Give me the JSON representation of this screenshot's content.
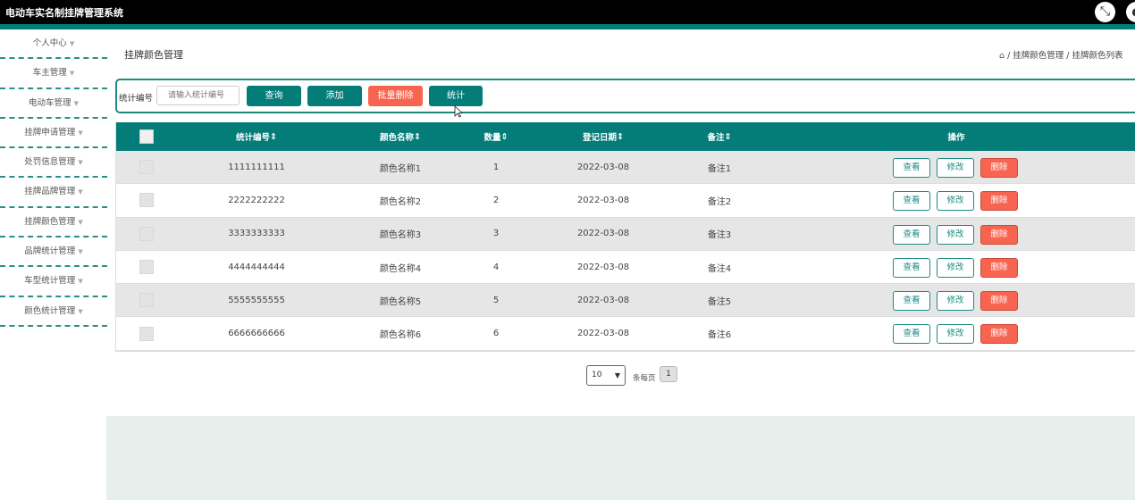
{
  "app": {
    "title": "电动车实名制挂牌管理系统"
  },
  "header_icons": {
    "fullscreen": "collapse-arrows-icon",
    "user": "user-icon"
  },
  "sidebar": {
    "items": [
      {
        "label": "个人中心"
      },
      {
        "label": "车主管理"
      },
      {
        "label": "电动车管理"
      },
      {
        "label": "挂牌申请管理"
      },
      {
        "label": "处罚信息管理"
      },
      {
        "label": "挂牌品牌管理"
      },
      {
        "label": "挂牌颜色管理"
      },
      {
        "label": "品牌统计管理"
      },
      {
        "label": "车型统计管理"
      },
      {
        "label": "颜色统计管理"
      }
    ]
  },
  "page": {
    "title": "挂牌颜色管理",
    "breadcrumb": "/ 挂牌颜色管理 / 挂牌颜色列表"
  },
  "search": {
    "label": "统计编号",
    "placeholder": "请输入统计编号",
    "query_button": "查询",
    "add_button": "添加",
    "batch_delete_button": "批量删除",
    "stats_button": "统计"
  },
  "table": {
    "headers": [
      "统计编号",
      "颜色名称",
      "数量",
      "登记日期",
      "备注",
      "操作"
    ],
    "sort_mark": "⇕",
    "rows": [
      {
        "id": "1111111111",
        "color": "颜色名称1",
        "qty": "1",
        "date": "2022-03-08",
        "note": "备注1"
      },
      {
        "id": "2222222222",
        "color": "颜色名称2",
        "qty": "2",
        "date": "2022-03-08",
        "note": "备注2"
      },
      {
        "id": "3333333333",
        "color": "颜色名称3",
        "qty": "3",
        "date": "2022-03-08",
        "note": "备注3"
      },
      {
        "id": "4444444444",
        "color": "颜色名称4",
        "qty": "4",
        "date": "2022-03-08",
        "note": "备注4"
      },
      {
        "id": "5555555555",
        "color": "颜色名称5",
        "qty": "5",
        "date": "2022-03-08",
        "note": "备注5"
      },
      {
        "id": "6666666666",
        "color": "颜色名称6",
        "qty": "6",
        "date": "2022-03-08",
        "note": "备注6"
      }
    ],
    "actions": {
      "view": "查看",
      "edit": "修改",
      "delete": "删除"
    }
  },
  "pager": {
    "page_size": "10",
    "per_page_label": "条每页",
    "current_page": "1"
  },
  "colors": {
    "primary": "#047d79",
    "danger": "#f76450",
    "header_bg": "#000000"
  }
}
